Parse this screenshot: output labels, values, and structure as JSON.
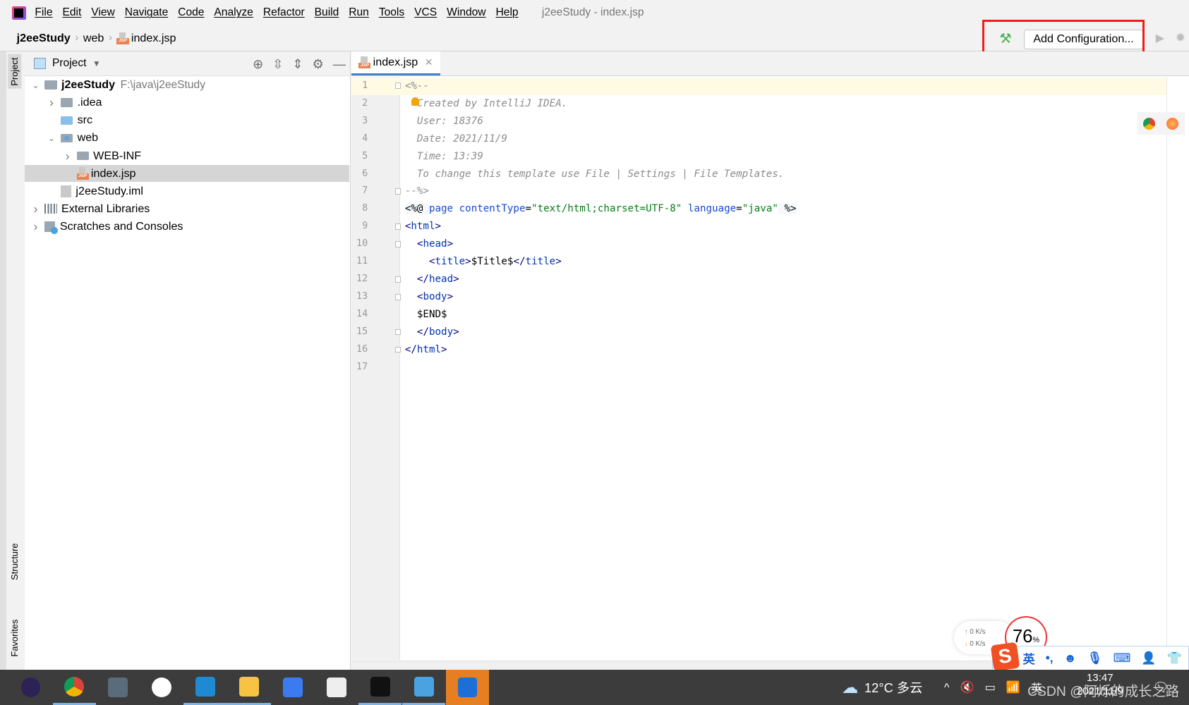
{
  "menu": {
    "items": [
      "File",
      "Edit",
      "View",
      "Navigate",
      "Code",
      "Analyze",
      "Refactor",
      "Build",
      "Run",
      "Tools",
      "VCS",
      "Window",
      "Help"
    ],
    "window_title": "j2eeStudy - index.jsp"
  },
  "breadcrumb": [
    "j2eeStudy",
    "web",
    "index.jsp"
  ],
  "toolbar": {
    "add_configuration": "Add Configuration...",
    "icons": [
      "hammer-icon",
      "run-icon",
      "debug-icon"
    ],
    "highlight_color": "#f21b1b"
  },
  "side_tabs": {
    "project": "Project",
    "structure": "Structure",
    "favorites": "Favorites"
  },
  "project": {
    "title": "Project",
    "tree": [
      {
        "label": "j2eeStudy",
        "path": "F:\\java\\j2eeStudy",
        "level": 0,
        "expanded": true,
        "icon": "module-folder"
      },
      {
        "label": ".idea",
        "level": 1,
        "expanded": false,
        "icon": "folder"
      },
      {
        "label": "src",
        "level": 1,
        "icon": "source-folder"
      },
      {
        "label": "web",
        "level": 1,
        "expanded": true,
        "icon": "web-folder"
      },
      {
        "label": "WEB-INF",
        "level": 2,
        "expanded": false,
        "icon": "folder"
      },
      {
        "label": "index.jsp",
        "level": 2,
        "icon": "jsp-file",
        "selected": true
      },
      {
        "label": "j2eeStudy.iml",
        "level": 1,
        "icon": "iml-file"
      },
      {
        "label": "External Libraries",
        "level": 0,
        "expanded": false,
        "icon": "library"
      },
      {
        "label": "Scratches and Consoles",
        "level": 0,
        "expanded": false,
        "icon": "scratches"
      }
    ]
  },
  "editor": {
    "tab": "index.jsp",
    "current_line": 1,
    "lines": [
      [
        [
          "comment",
          "<%--"
        ]
      ],
      [
        [
          "comment",
          "  Created by IntelliJ IDEA."
        ]
      ],
      [
        [
          "comment",
          "  User: 18376"
        ]
      ],
      [
        [
          "comment",
          "  Date: 2021/11/9"
        ]
      ],
      [
        [
          "comment",
          "  Time: 13:39"
        ]
      ],
      [
        [
          "comment",
          "  To change this template use File | Settings | File Templates."
        ]
      ],
      [
        [
          "comment",
          "--%>"
        ]
      ],
      [
        [
          "dir",
          "<%@ "
        ],
        [
          "attr",
          "page "
        ],
        [
          "attr",
          "contentType"
        ],
        [
          "plain",
          "="
        ],
        [
          "str",
          "\"text/html;charset=UTF-8\""
        ],
        [
          "plain",
          " "
        ],
        [
          "attr",
          "language"
        ],
        [
          "plain",
          "="
        ],
        [
          "str",
          "\"java\""
        ],
        [
          "dir",
          " %>"
        ]
      ],
      [
        [
          "tag",
          "<"
        ],
        [
          "tagname",
          "html"
        ],
        [
          "tag",
          ">"
        ]
      ],
      [
        [
          "plain",
          "  "
        ],
        [
          "tag",
          "<"
        ],
        [
          "tagname",
          "head"
        ],
        [
          "tag",
          ">"
        ]
      ],
      [
        [
          "plain",
          "    "
        ],
        [
          "tag",
          "<"
        ],
        [
          "tagname",
          "title"
        ],
        [
          "tag",
          ">"
        ],
        [
          "plain",
          "$Title$"
        ],
        [
          "tag",
          "</"
        ],
        [
          "tagname",
          "title"
        ],
        [
          "tag",
          ">"
        ]
      ],
      [
        [
          "plain",
          "  "
        ],
        [
          "tag",
          "</"
        ],
        [
          "tagname",
          "head"
        ],
        [
          "tag",
          ">"
        ]
      ],
      [
        [
          "plain",
          "  "
        ],
        [
          "tag",
          "<"
        ],
        [
          "tagname",
          "body"
        ],
        [
          "tag",
          ">"
        ]
      ],
      [
        [
          "plain",
          "  $END$"
        ]
      ],
      [
        [
          "plain",
          "  "
        ],
        [
          "tag",
          "</"
        ],
        [
          "tagname",
          "body"
        ],
        [
          "tag",
          ">"
        ]
      ],
      [
        [
          "tag",
          "</"
        ],
        [
          "tagname",
          "html"
        ],
        [
          "tag",
          ">"
        ]
      ],
      []
    ],
    "fold_lines": [
      1,
      7,
      9,
      10,
      12,
      13,
      15,
      16
    ]
  },
  "widgets": {
    "net_up": "0  K/s",
    "net_down": "0  K/s",
    "cpu_value": "76",
    "cpu_unit": "%",
    "ime_lang": "英"
  },
  "taskbar": {
    "apps": [
      "eclipse",
      "chrome",
      "remote-desktop",
      "app-dots",
      "vscode",
      "file-explorer",
      "feishu",
      "typora",
      "terminal",
      "control-panel",
      "security-shield"
    ],
    "weather": "12°C 多云",
    "ime": "英",
    "time": "13:47",
    "date": "2021/11/9",
    "watermark": "CSDN @阿烁的成长之路"
  }
}
